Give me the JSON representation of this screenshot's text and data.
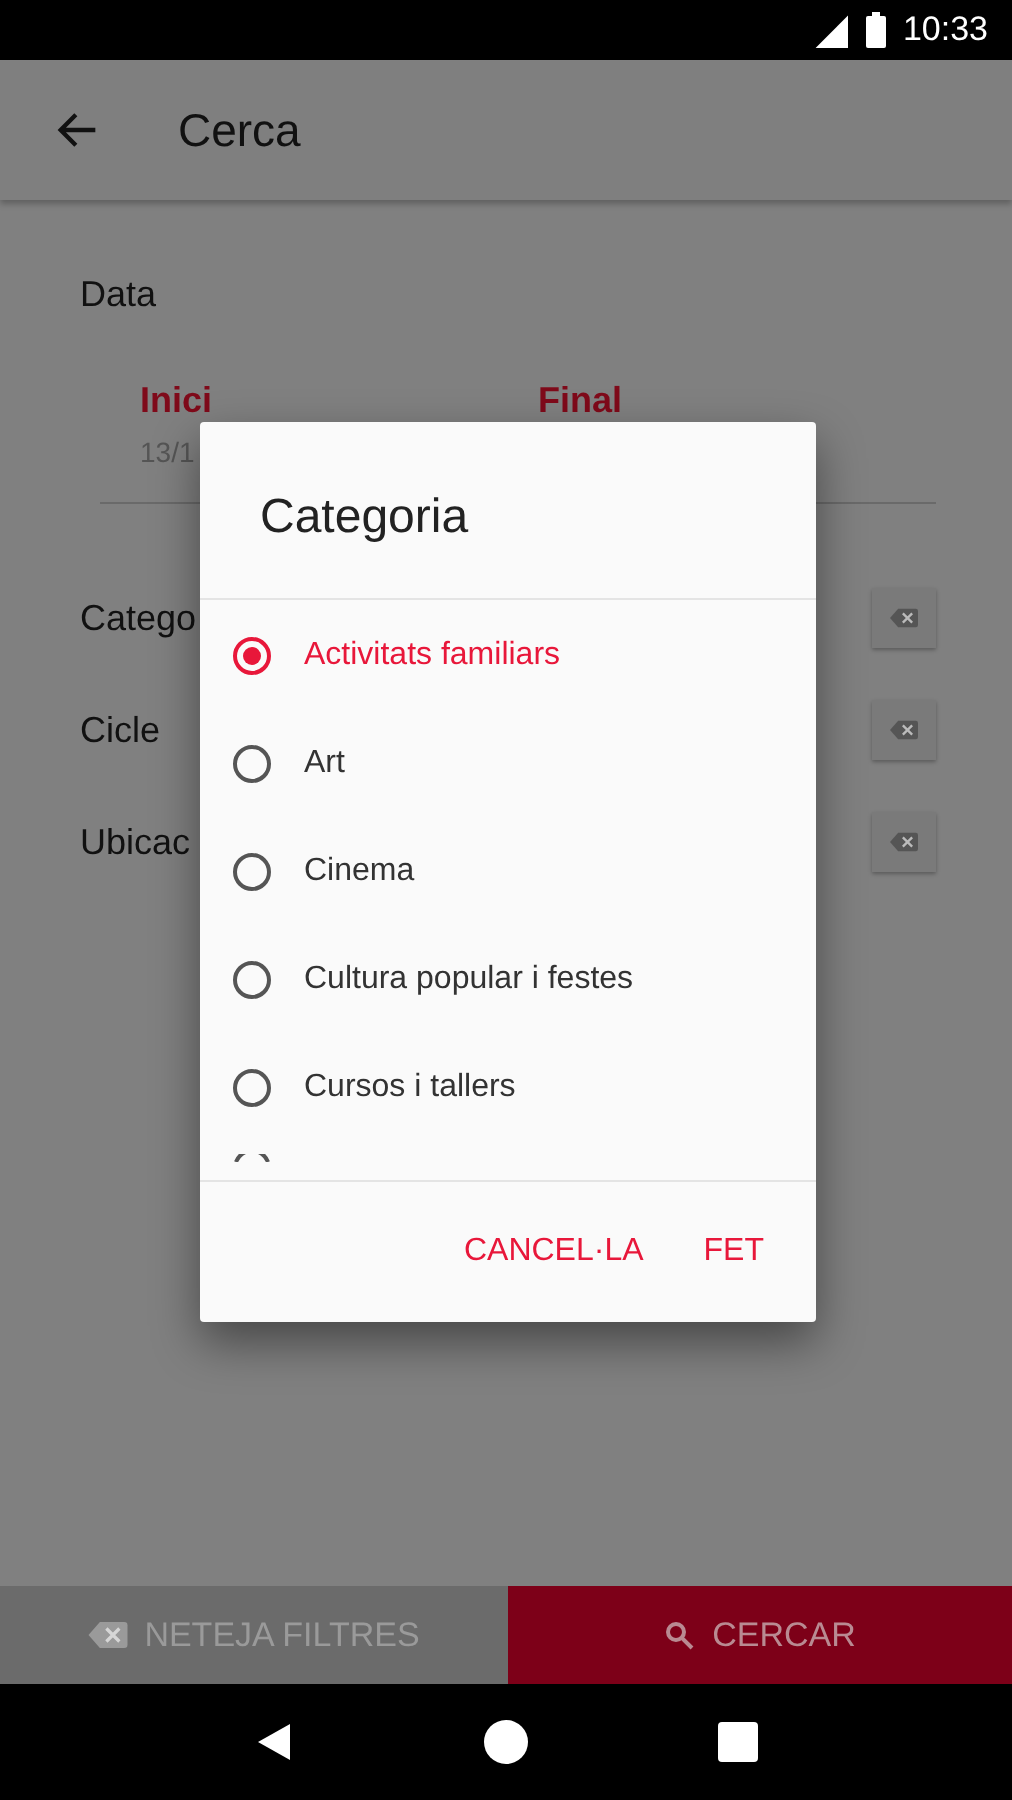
{
  "status_bar": {
    "time": "10:33"
  },
  "app_bar": {
    "title": "Cerca"
  },
  "date_section": {
    "label": "Data",
    "start_label": "Inici",
    "start_value": "13/1",
    "end_label": "Final"
  },
  "filters": [
    {
      "label": "Catego"
    },
    {
      "label": "Cicle"
    },
    {
      "label": "Ubicac"
    }
  ],
  "dialog": {
    "title": "Categoria",
    "options": [
      {
        "label": "Activitats familiars",
        "selected": true
      },
      {
        "label": "Art",
        "selected": false
      },
      {
        "label": "Cinema",
        "selected": false
      },
      {
        "label": "Cultura popular i festes",
        "selected": false
      },
      {
        "label": "Cursos i tallers",
        "selected": false
      }
    ],
    "buttons": [
      "CANCEL·LA",
      "FET"
    ]
  },
  "bottom_bar": {
    "clear_label": "NETEJA FILTRES",
    "search_label": "CERCAR"
  }
}
